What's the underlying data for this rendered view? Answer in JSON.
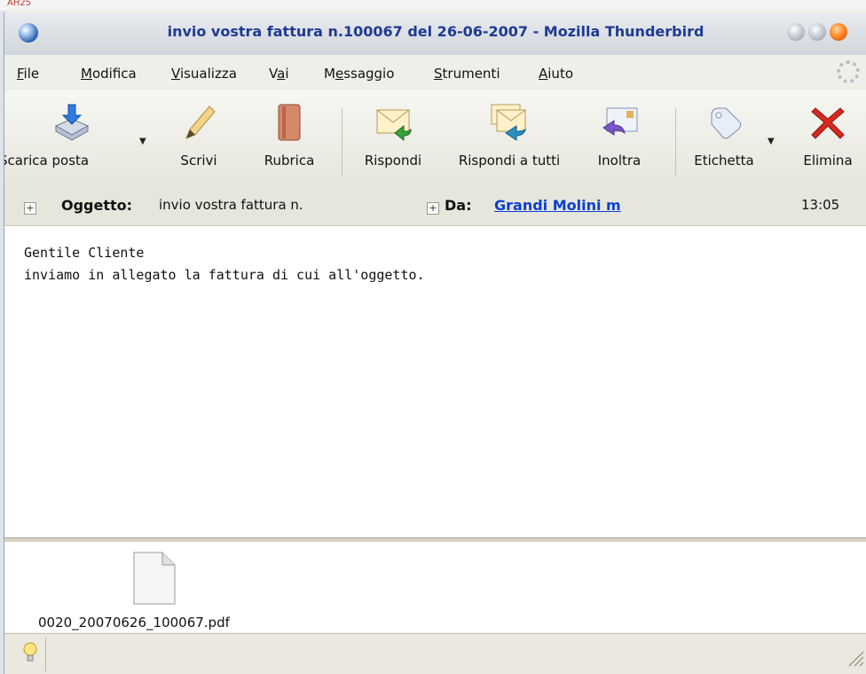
{
  "background": {
    "corner_text": "AH25"
  },
  "window": {
    "title": "invio vostra fattura n.100067 del 26-06-2007 - Mozilla Thunderbird"
  },
  "menubar": {
    "items": [
      {
        "label": "File",
        "underline": "F"
      },
      {
        "label": "Modifica",
        "underline": "M"
      },
      {
        "label": "Visualizza",
        "underline": "V"
      },
      {
        "label": "Vai",
        "underline": "a"
      },
      {
        "label": "Messaggio",
        "underline": "e"
      },
      {
        "label": "Strumenti",
        "underline": "S"
      },
      {
        "label": "Aiuto",
        "underline": "A"
      }
    ]
  },
  "toolbar": {
    "get_mail": "Scarica posta",
    "compose": "Scrivi",
    "address_book": "Rubrica",
    "reply": "Rispondi",
    "reply_all": "Rispondi a tutti",
    "forward": "Inoltra",
    "tag": "Etichetta",
    "delete": "Elimina"
  },
  "header": {
    "subject_label": "Oggetto:",
    "subject_value": "invio vostra fattura n.",
    "from_label": "Da:",
    "from_value": "Grandi Molini m",
    "time": "13:05"
  },
  "message": {
    "line1": "Gentile Cliente",
    "line2": "inviamo in allegato la fattura di cui all'oggetto."
  },
  "attachment": {
    "file_name": "0020_20070626_100067.pdf"
  },
  "colors": {
    "title": "#1f3a93",
    "link": "#0b3fd1",
    "close_button": "#ff8a2b"
  },
  "icons": [
    "app-icon",
    "get-mail-icon",
    "compose-icon",
    "address-book-icon",
    "reply-icon",
    "reply-all-icon",
    "forward-icon",
    "tag-icon",
    "delete-icon",
    "file-icon",
    "lightbulb-icon",
    "throbber-icon",
    "resize-grip-icon"
  ]
}
